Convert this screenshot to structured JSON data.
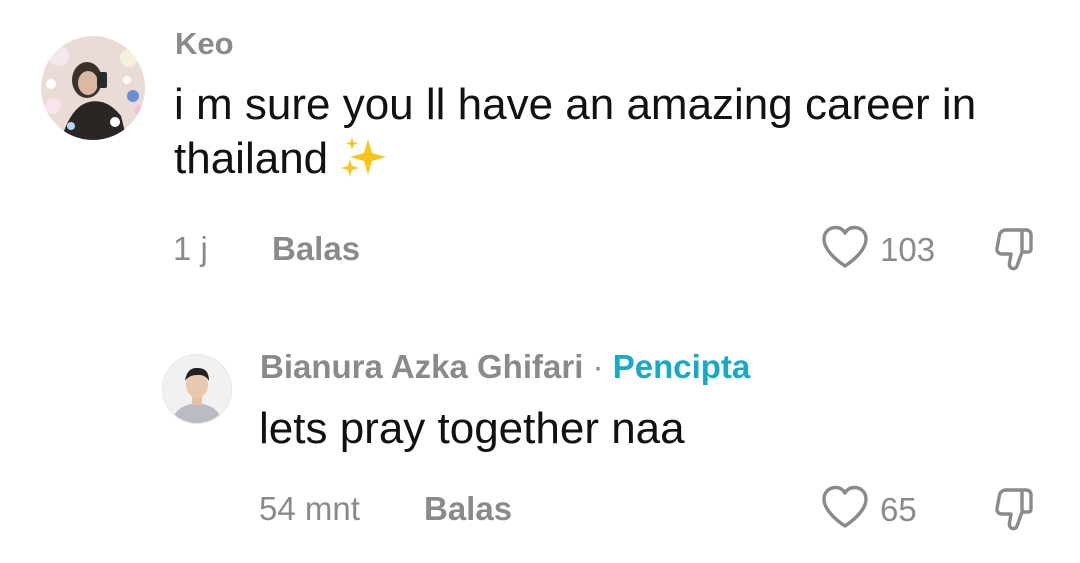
{
  "comments": [
    {
      "username": "Keo",
      "text": "i m sure you ll have an amazing career in thailand",
      "emoji": "sparkles-emoji",
      "time": "1 j",
      "reply_label": "Balas",
      "likes": "103",
      "is_creator": false
    },
    {
      "username": "Bianura Azka Ghifari",
      "separator": "·",
      "creator_label": "Pencipta",
      "text": "lets pray together naa",
      "time": "54 mnt",
      "reply_label": "Balas",
      "likes": "65",
      "is_creator": true
    }
  ],
  "icons": {
    "like": "heart-outline-icon",
    "dislike": "thumbs-down-outline-icon"
  },
  "colors": {
    "text_primary": "#111111",
    "text_secondary": "#8a8a8a",
    "creator_accent": "#1aa8c8",
    "background": "#ffffff"
  }
}
